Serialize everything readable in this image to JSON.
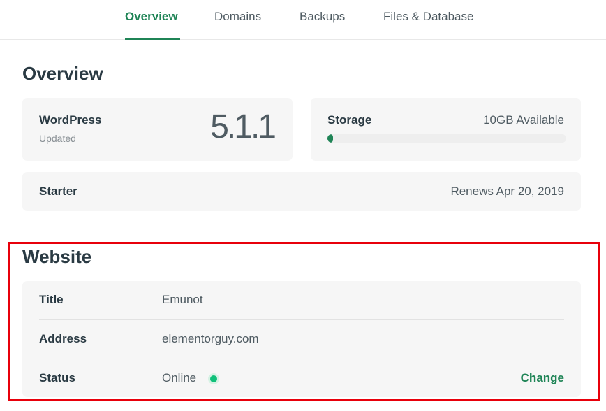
{
  "tabs": [
    {
      "label": "Overview",
      "active": true
    },
    {
      "label": "Domains",
      "active": false
    },
    {
      "label": "Backups",
      "active": false
    },
    {
      "label": "Files & Database",
      "active": false
    }
  ],
  "overview": {
    "title": "Overview",
    "wordpress": {
      "name": "WordPress",
      "status": "Updated",
      "version": "5.1.1"
    },
    "storage": {
      "label": "Storage",
      "available": "10GB Available",
      "used_fraction": 0.02
    },
    "plan": {
      "name": "Starter",
      "renewal": "Renews Apr 20, 2019"
    }
  },
  "website": {
    "title": "Website",
    "rows": [
      {
        "label": "Title",
        "value": "Emunot"
      },
      {
        "label": "Address",
        "value": "elementorguy.com"
      },
      {
        "label": "Status",
        "value": "Online",
        "action": "Change"
      }
    ]
  },
  "colors": {
    "accent": "#1f8456",
    "online": "#10c07a",
    "highlight_frame": "#e8000b",
    "card_bg": "#f6f6f6"
  }
}
